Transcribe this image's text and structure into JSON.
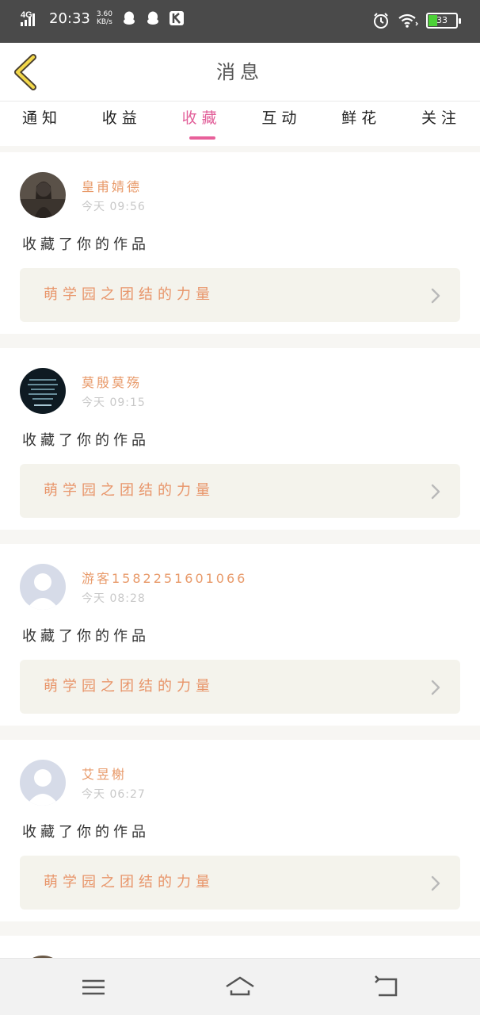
{
  "status_bar": {
    "network": "4G",
    "time": "20:33",
    "speed_value": "3.60",
    "speed_unit": "KB/s",
    "battery": "33",
    "battery_level": 0.33,
    "icons": [
      "signal-icon",
      "qq-icon",
      "qq-icon",
      "k-app-icon",
      "alarm-icon",
      "wifi-icon",
      "battery-icon"
    ]
  },
  "header": {
    "title": "消息",
    "back_icon": "chevron-left-icon"
  },
  "tabs": [
    {
      "label": "通知",
      "active": false
    },
    {
      "label": "收益",
      "active": false
    },
    {
      "label": "收藏",
      "active": true
    },
    {
      "label": "互动",
      "active": false
    },
    {
      "label": "鲜花",
      "active": false
    },
    {
      "label": "关注",
      "active": false
    }
  ],
  "messages": [
    {
      "username": "皇甫婧德",
      "time": "今天 09:56",
      "action": "收藏了你的作品",
      "work_title": "萌学园之团结的力量"
    },
    {
      "username": "莫殷莫殇",
      "time": "今天 09:15",
      "action": "收藏了你的作品",
      "work_title": "萌学园之团结的力量"
    },
    {
      "username": "游客15822516010​66",
      "time": "今天 08:28",
      "action": "收藏了你的作品",
      "work_title": "萌学园之团结的力量"
    },
    {
      "username": "艾昱榭",
      "time": "今天 06:27",
      "action": "收藏了你的作品",
      "work_title": "萌学园之团结的力量"
    }
  ],
  "colors": {
    "accent_pink": "#e2609a",
    "username_orange": "#e89a6a",
    "work_card_bg": "#f4f3ec",
    "status_bar_bg": "#4a4a4a"
  },
  "nav_bar": [
    "menu-icon",
    "home-icon",
    "back-icon"
  ]
}
